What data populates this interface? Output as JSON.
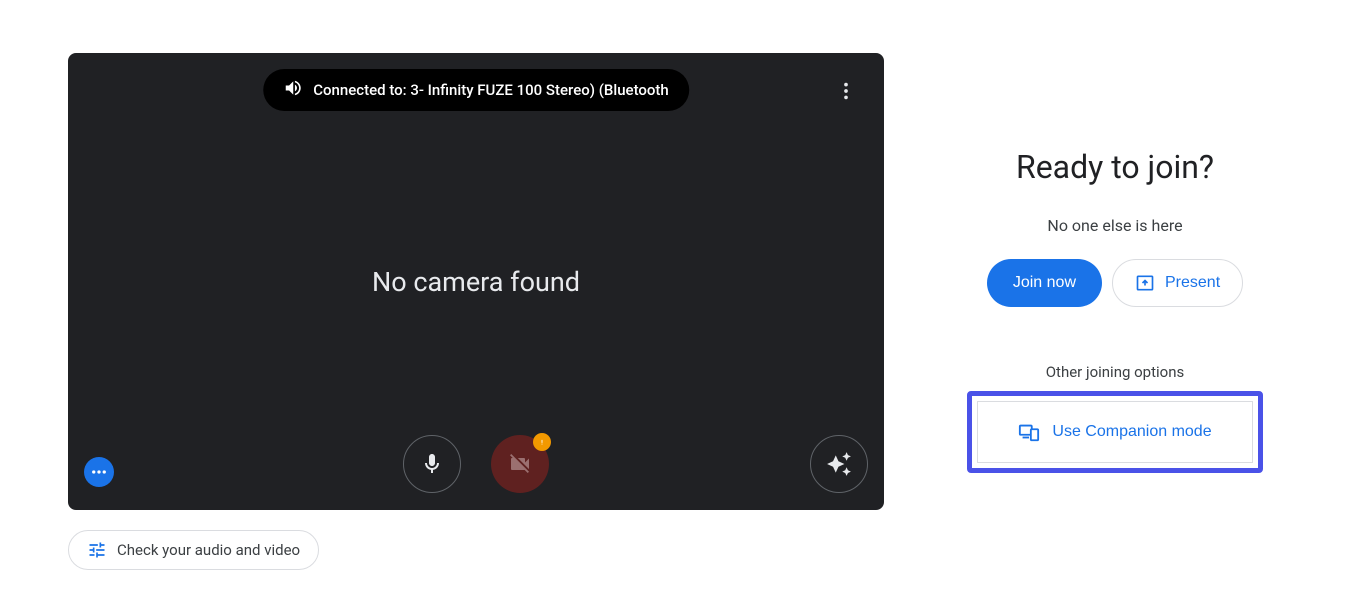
{
  "preview": {
    "audio_toast": "Connected to: 3- Infinity FUZE 100 Stereo) (Bluetooth",
    "no_camera_message": "No camera found"
  },
  "check_audio_label": "Check your audio and video",
  "right": {
    "title": "Ready to join?",
    "participants": "No one else is here",
    "join_label": "Join now",
    "present_label": "Present",
    "other_options_label": "Other joining options",
    "companion_label": "Use Companion mode"
  }
}
